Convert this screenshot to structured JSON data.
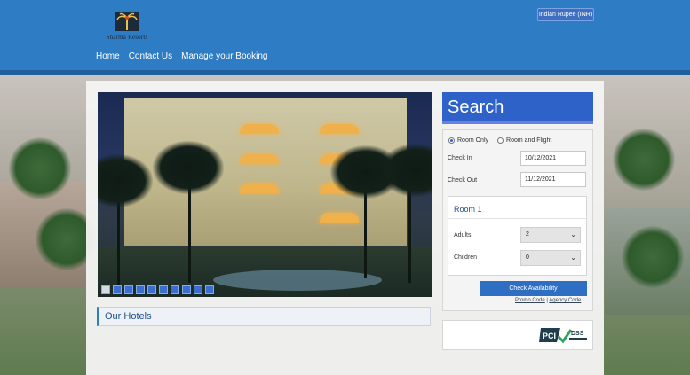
{
  "header": {
    "logo_text": "Sharma Resorts",
    "currency_label": "Indian Rupee (INR)"
  },
  "nav": {
    "items": [
      "Home",
      "Contact Us",
      "Manage your Booking"
    ]
  },
  "hero": {
    "slide_count": 10,
    "active_slide": 1
  },
  "our_hotels": {
    "title": "Our Hotels"
  },
  "search": {
    "title": "Search",
    "options": [
      "Room Only",
      "Room and Flight"
    ],
    "selected_option": "Room Only",
    "check_in_label": "Check In",
    "check_in_value": "10/12/2021",
    "check_out_label": "Check Out",
    "check_out_value": "11/12/2021",
    "room_title": "Room 1",
    "adults_label": "Adults",
    "adults_value": "2",
    "children_label": "Children",
    "children_value": "0",
    "button_label": "Check Availability",
    "promo_link": "Promo Code",
    "agency_link": "Agency Code",
    "separator": "|"
  },
  "badge": {
    "pci_text": "PCI",
    "dss_text": "DSS"
  },
  "colors": {
    "header_blue": "#2e7cc4",
    "search_blue": "#2e62c8"
  }
}
